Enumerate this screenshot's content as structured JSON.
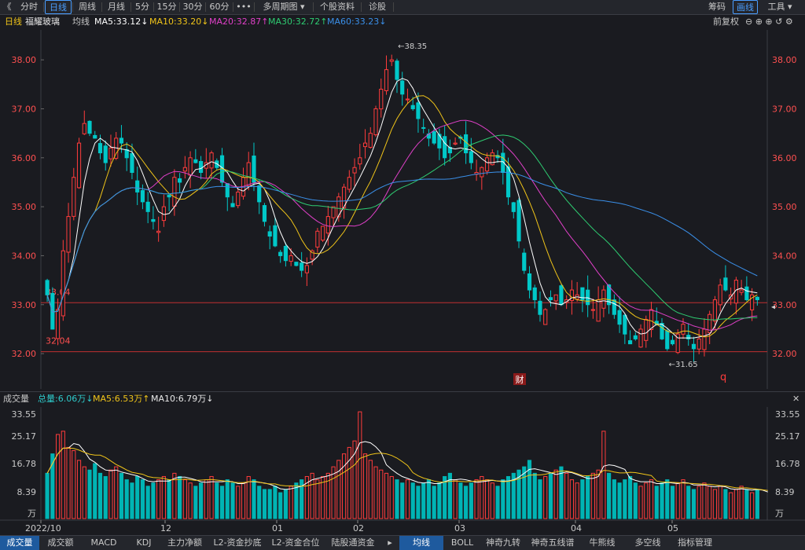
{
  "toolbar": {
    "back": "《",
    "periods": [
      "分时",
      "日线",
      "周线",
      "月线",
      "5分",
      "15分",
      "30分",
      "60分",
      "•••",
      "多周期图 ▾",
      "个股资料",
      "诊股"
    ],
    "active_index": 1,
    "right": [
      "筹码",
      "画线",
      "工具 ▾"
    ],
    "right_active_index": 1
  },
  "ma_bar": {
    "period": "日线",
    "stock_name": "福耀玻璃",
    "avg_line": "均线",
    "ma5": "MA5:33.12↓",
    "ma10": "MA10:33.20↓",
    "ma20": "MA20:32.87↑",
    "ma30": "MA30:32.72↑",
    "ma60": "MA60:33.23↓",
    "adjust": "前复权",
    "colors": {
      "ma5": "#ffffff",
      "ma10": "#f0c419",
      "ma20": "#e040c8",
      "ma30": "#2ecc71",
      "ma60": "#3a8fe8"
    }
  },
  "vol_bar": {
    "label": "成交量",
    "total": "总量:6.06万↓",
    "ma5": "MA5:6.53万↑",
    "ma10": "MA10:6.79万↓"
  },
  "tabs": [
    "成交量",
    "成交额",
    "MACD",
    "KDJ",
    "主力净额",
    "L2-资金抄底",
    "L2-资金合位",
    "陆股通资金",
    "▸",
    "均线",
    "BOLL",
    "神奇九转",
    "神奇五线谱",
    "牛熊线",
    "多空线",
    "指标管理"
  ],
  "tab_active": [
    0,
    9
  ],
  "chart_data": {
    "type": "candlestick",
    "price_axis": {
      "ticks": [
        "38.00",
        "37.00",
        "36.00",
        "35.00",
        "34.00",
        "33.00",
        "32.00"
      ],
      "ylim": [
        31.6,
        38.5
      ]
    },
    "volume_axis": {
      "ticks": [
        "33.55",
        "25.17",
        "16.78",
        "8.39",
        "万"
      ],
      "ylim": [
        0,
        34
      ]
    },
    "x_labels": [
      "2022/10",
      "12",
      "01",
      "02",
      "03",
      "04",
      "05"
    ],
    "annotations": {
      "high": "38.35",
      "low": "31.65",
      "line_33": "33.04",
      "line_32": "32.04",
      "finance_marker": "财",
      "q_marker": "q"
    },
    "closes": [
      33.2,
      32.5,
      32.9,
      34.1,
      34.8,
      35.6,
      36.3,
      36.7,
      36.5,
      36.4,
      36.1,
      35.9,
      36.2,
      36.4,
      36.3,
      36.0,
      35.7,
      35.3,
      35.1,
      34.9,
      34.7,
      34.5,
      35.0,
      35.2,
      35.6,
      35.5,
      35.8,
      36.0,
      35.9,
      35.7,
      35.9,
      36.1,
      35.8,
      35.5,
      35.2,
      35.0,
      35.3,
      35.6,
      35.9,
      35.5,
      35.1,
      34.7,
      34.4,
      34.2,
      34.0,
      33.9,
      34.0,
      33.8,
      33.7,
      33.8,
      34.1,
      34.5,
      34.6,
      34.8,
      35.0,
      35.2,
      35.4,
      35.6,
      35.8,
      36.0,
      36.3,
      36.5,
      37.0,
      37.4,
      37.8,
      38.0,
      37.6,
      37.3,
      37.2,
      37.0,
      36.8,
      36.6,
      36.4,
      36.3,
      36.2,
      36.0,
      36.1,
      36.3,
      36.4,
      36.1,
      35.9,
      35.7,
      35.8,
      36.0,
      36.1,
      36.0,
      35.7,
      35.2,
      34.9,
      34.3,
      33.7,
      33.3,
      33.1,
      32.8,
      32.9,
      33.1,
      33.2,
      33.0,
      33.1,
      33.3,
      33.2,
      33.1,
      33.0,
      32.9,
      33.1,
      33.3,
      33.0,
      32.8,
      32.6,
      32.4,
      32.2,
      32.3,
      32.5,
      32.7,
      32.9,
      32.6,
      32.3,
      32.1,
      32.2,
      32.4,
      32.6,
      32.3,
      32.1,
      32.3,
      32.5,
      32.8,
      33.1,
      33.4,
      33.3,
      33.2,
      33.5,
      33.3,
      33.1,
      33.2,
      33.1
    ],
    "volumes": [
      14,
      20,
      26,
      27,
      22,
      21,
      18,
      16,
      15,
      17,
      14,
      13,
      15,
      16,
      14,
      12,
      11,
      13,
      12,
      10,
      11,
      12,
      13,
      12,
      14,
      13,
      12,
      11,
      10,
      11,
      12,
      13,
      11,
      10,
      12,
      11,
      10,
      11,
      13,
      12,
      10,
      9,
      9,
      10,
      8,
      9,
      10,
      11,
      12,
      13,
      14,
      12,
      13,
      14,
      16,
      18,
      20,
      22,
      24,
      33,
      20,
      18,
      16,
      15,
      14,
      13,
      12,
      11,
      12,
      11,
      10,
      11,
      12,
      10,
      11,
      13,
      14,
      12,
      11,
      10,
      11,
      12,
      13,
      12,
      11,
      10,
      12,
      13,
      14,
      15,
      16,
      18,
      14,
      12,
      13,
      14,
      15,
      16,
      14,
      12,
      11,
      12,
      13,
      14,
      15,
      27,
      14,
      12,
      11,
      12,
      13,
      11,
      10,
      11,
      12,
      10,
      11,
      12,
      10,
      11,
      12,
      10,
      9,
      10,
      11,
      10,
      9,
      10,
      9,
      8,
      9,
      10,
      9,
      8,
      9,
      8,
      7
    ]
  }
}
